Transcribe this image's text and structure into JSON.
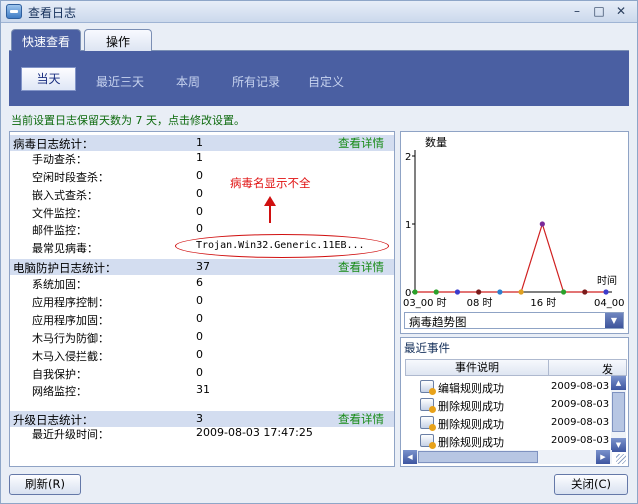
{
  "window": {
    "title": "查看日志"
  },
  "titlebar": {
    "minimize": "–",
    "maximize": "□",
    "close": "✕"
  },
  "tabs": [
    {
      "label": "快速查看"
    },
    {
      "label": "操作"
    }
  ],
  "periods": [
    "当天",
    "最近三天",
    "本周",
    "所有记录",
    "自定义"
  ],
  "notice": "当前设置日志保留天数为 7 天，点击修改设置。",
  "virus_log": {
    "title": "病毒日志统计：",
    "value": "1",
    "link": "查看详情",
    "rows": [
      {
        "name": "手动查杀：",
        "value": "1"
      },
      {
        "name": "空闲时段查杀：",
        "value": "0"
      },
      {
        "name": "嵌入式查杀：",
        "value": "0"
      },
      {
        "name": "文件监控：",
        "value": "0"
      },
      {
        "name": "邮件监控：",
        "value": "0"
      },
      {
        "name": "最常见病毒：",
        "value": "Trojan.Win32.Generic.11EB..."
      }
    ]
  },
  "annotation": "病毒名显示不全",
  "protect_log": {
    "title": "电脑防护日志统计：",
    "value": "37",
    "link": "查看详情",
    "rows": [
      {
        "name": "系统加固：",
        "value": "6"
      },
      {
        "name": "应用程序控制：",
        "value": "0"
      },
      {
        "name": "应用程序加固：",
        "value": "0"
      },
      {
        "name": "木马行为防御：",
        "value": "0"
      },
      {
        "name": "木马入侵拦截：",
        "value": "0"
      },
      {
        "name": "自我保护：",
        "value": "0"
      },
      {
        "name": "网络监控：",
        "value": "31"
      }
    ]
  },
  "upgrade_log": {
    "title": "升级日志统计：",
    "value": "3",
    "link": "查看详情",
    "rows": [
      {
        "name": "最近升级时间：",
        "value": "2009-08-03 17:47:25"
      }
    ]
  },
  "chart_data": {
    "type": "line",
    "ylabel": "数量",
    "xlabel": "时间",
    "yticks": [
      "0",
      "1",
      "2"
    ],
    "ylim": [
      0,
      2
    ],
    "xticks": [
      "03_00 时",
      "08 时",
      "16 时",
      "04_00 时"
    ],
    "x": [
      0,
      1,
      2,
      3,
      4,
      5,
      6,
      7,
      8,
      9
    ],
    "values": [
      0,
      0,
      0,
      0,
      0,
      0,
      1,
      0,
      0,
      0
    ],
    "point_colors": [
      "#2aa12a",
      "#2aa12a",
      "#3b3bcc",
      "#7a1a1a",
      "#2a7fd0",
      "#e0a020",
      "#7a2a9a",
      "#2aa12a",
      "#7a1a1a",
      "#3b3bcc"
    ],
    "line_color": "#d02020"
  },
  "chart_select": {
    "value": "病毒趋势图"
  },
  "events": {
    "title": "最近事件",
    "col1": "事件说明",
    "col2": "发",
    "rows": [
      {
        "label": "编辑规则成功",
        "date": "2009-08-03"
      },
      {
        "label": "删除规则成功",
        "date": "2009-08-03"
      },
      {
        "label": "删除规则成功",
        "date": "2009-08-03"
      },
      {
        "label": "删除规则成功",
        "date": "2009-08-03"
      }
    ]
  },
  "buttons": {
    "refresh": "刷新(R)",
    "close": "关闭(C)"
  }
}
